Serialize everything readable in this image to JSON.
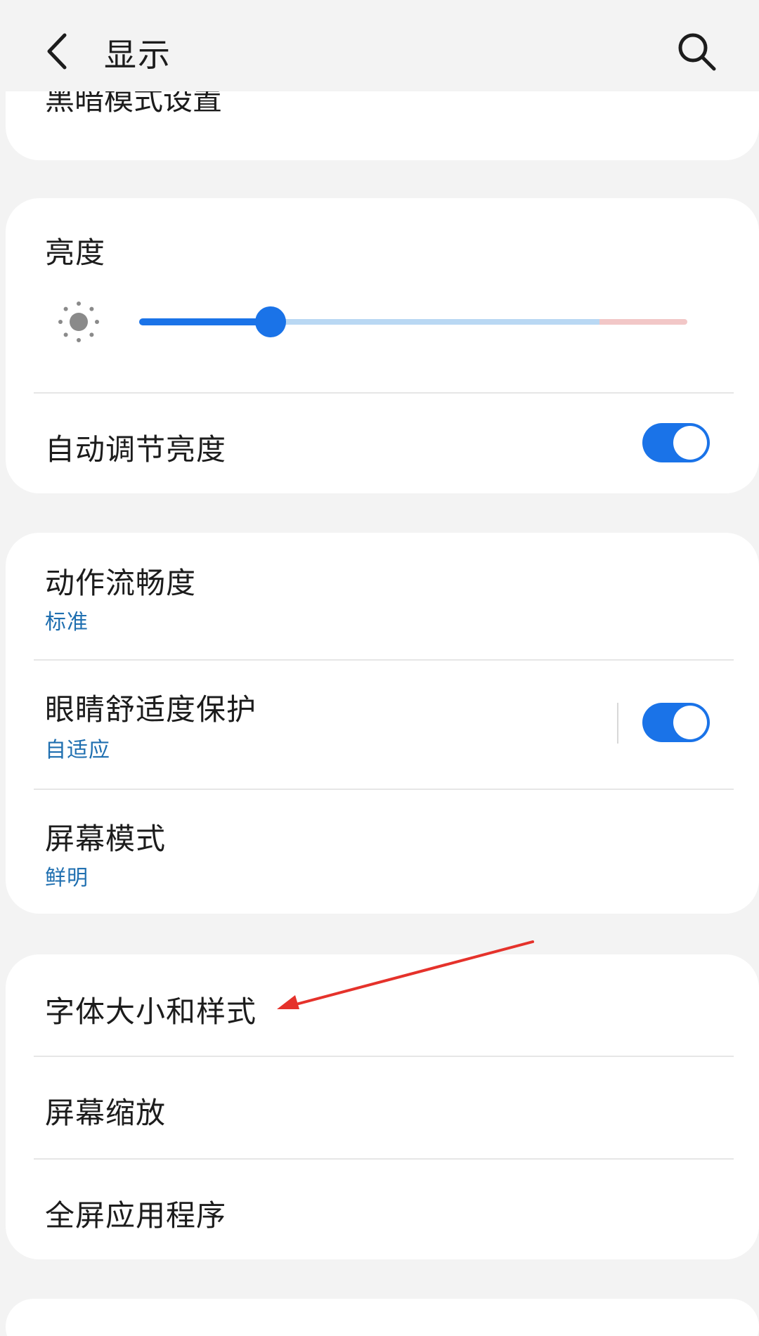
{
  "header": {
    "title": "显示",
    "back_icon": "chevron-left-icon",
    "search_icon": "search-icon"
  },
  "top_card": {
    "partial_label": "黑暗模式设置"
  },
  "brightness_card": {
    "title": "亮度",
    "slider_icon": "sun-icon",
    "slider_level": 0.24,
    "auto_brightness": {
      "label": "自动调节亮度",
      "enabled": true
    }
  },
  "display_card": {
    "items": [
      {
        "label": "动作流畅度",
        "sub": "标准"
      },
      {
        "label": "眼睛舒适度保护",
        "sub": "自适应",
        "toggle_enabled": true
      },
      {
        "label": "屏幕模式",
        "sub": "鲜明"
      }
    ]
  },
  "font_card": {
    "items": [
      {
        "label": "字体大小和样式"
      },
      {
        "label": "屏幕缩放"
      },
      {
        "label": "全屏应用程序"
      }
    ]
  },
  "annotation": {
    "arrow_color": "#e5322b"
  },
  "colors": {
    "accent": "#1a73e8",
    "subtitle": "#1f6fb0",
    "background": "#f3f3f3",
    "card": "#ffffff"
  }
}
